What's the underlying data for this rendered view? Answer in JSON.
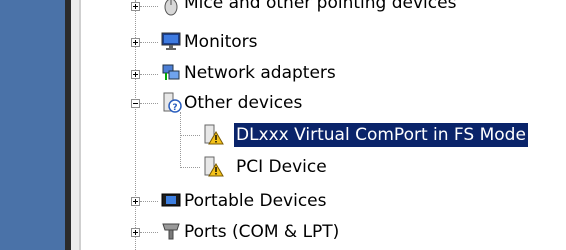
{
  "device_tree": {
    "items": [
      {
        "label": "Mice and other pointing devices",
        "icon": "mouse-icon",
        "expander": "plus"
      },
      {
        "label": "Monitors",
        "icon": "monitor-icon",
        "expander": "plus"
      },
      {
        "label": "Network adapters",
        "icon": "network-adapter-icon",
        "expander": "plus"
      },
      {
        "label": "Other devices",
        "icon": "unknown-device-icon",
        "expander": "minus"
      },
      {
        "label": "DLxxx Virtual ComPort in FS Mode",
        "icon": "warning-device-icon",
        "selected": true
      },
      {
        "label": "PCI Device",
        "icon": "warning-device-icon"
      },
      {
        "label": "Portable Devices",
        "icon": "portable-device-icon",
        "expander": "plus"
      },
      {
        "label": "Ports (COM & LPT)",
        "icon": "port-icon",
        "expander": "plus"
      }
    ]
  },
  "colors": {
    "selection_bg": "#0a246a",
    "selection_text": "#ffffff",
    "sidebar": "#4a72a8"
  }
}
